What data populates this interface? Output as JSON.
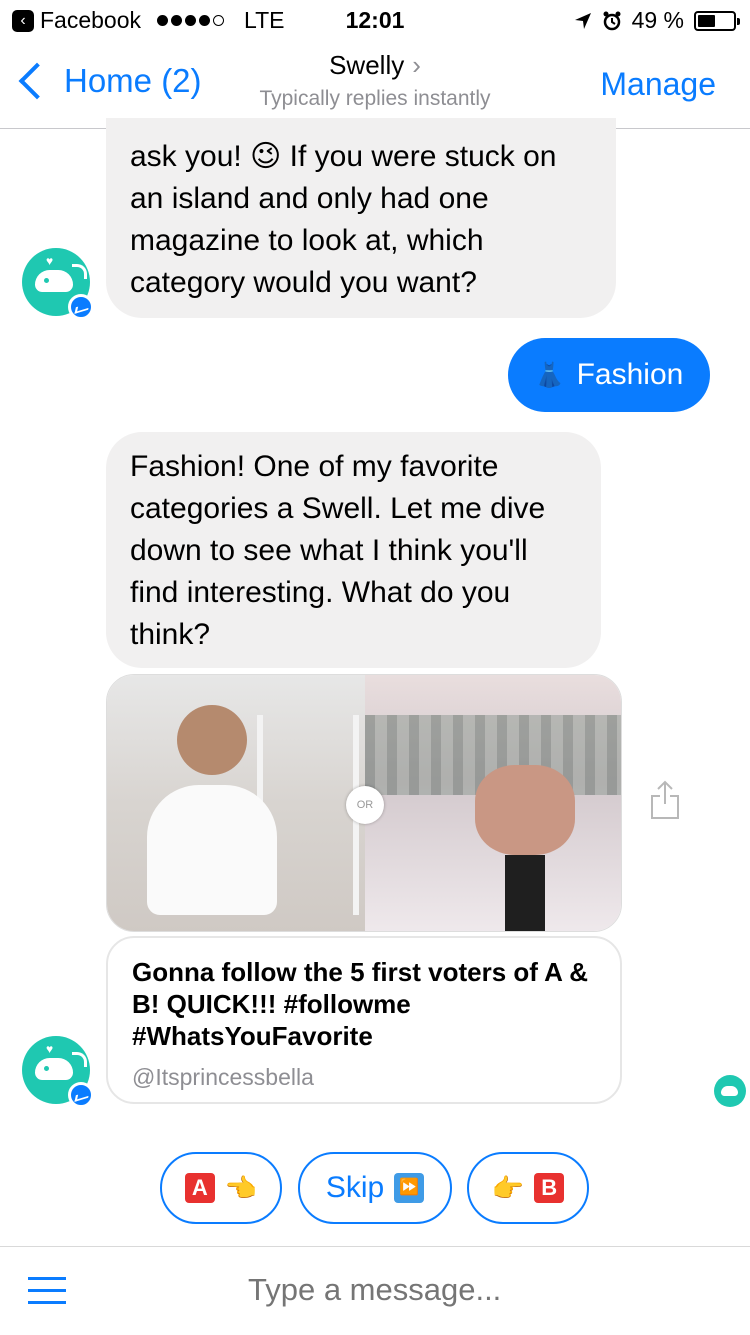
{
  "status_bar": {
    "app_back": "Facebook",
    "carrier": "LTE",
    "time": "12:01",
    "battery": "49 %",
    "battery_level": 0.49
  },
  "nav": {
    "back_label": "Home (2)",
    "title": "Swelly",
    "subtitle": "Typically replies instantly",
    "manage_label": "Manage"
  },
  "messages": {
    "bot_1": "ask you! 😉 If you were stuck on an island and only had one magazine to look at, which category would you want?",
    "user_1_emoji": "👗",
    "user_1": "Fashion",
    "bot_2": "Fashion! One of my favorite categories a Swell. Let me dive down to see what I think you'll find interesting. What do you think?",
    "image_or": "OR",
    "caption": "Gonna follow the 5 first voters of A & B! QUICK!!! #followme #WhatsYouFavorite",
    "caption_user": "@Itsprincessbella"
  },
  "quick_replies": {
    "a_letter": "A",
    "a_hand": "👈",
    "skip_label": "Skip",
    "skip_icon": "⏩",
    "b_hand": "👉",
    "b_letter": "B"
  },
  "composer": {
    "placeholder": "Type a message..."
  },
  "colors": {
    "accent": "#0a7cff",
    "bot_bubble": "#f1f0f0",
    "avatar": "#1fc8b1"
  }
}
